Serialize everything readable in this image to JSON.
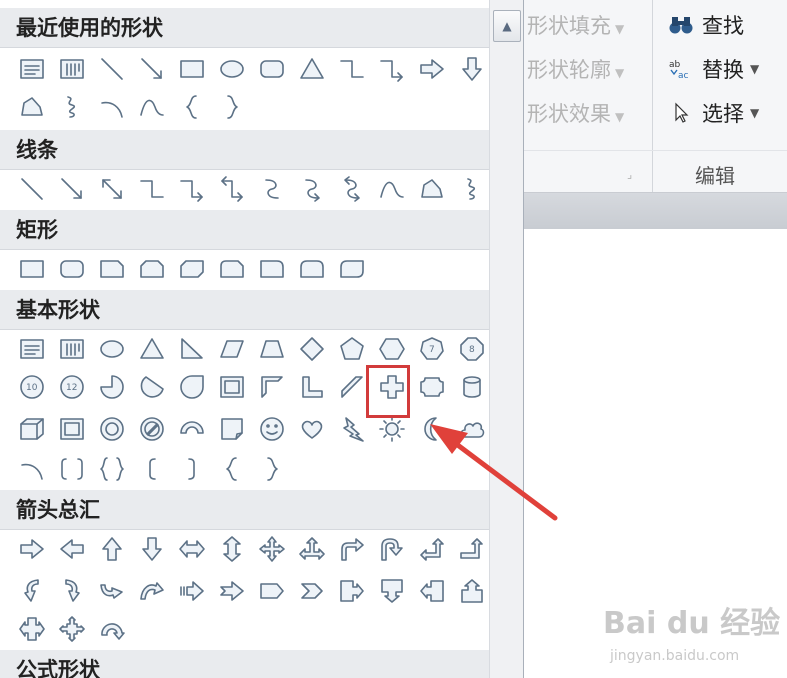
{
  "ribbon": {
    "format_items": [
      {
        "label": "形状填充",
        "has_dropdown": true
      },
      {
        "label": "形状轮廓",
        "has_dropdown": true
      },
      {
        "label": "形状效果",
        "has_dropdown": true
      }
    ],
    "edit_items": [
      {
        "label": "查找",
        "icon": "binoculars-icon",
        "has_dropdown": false
      },
      {
        "label": "替换",
        "icon": "replace-icon",
        "has_dropdown": true
      },
      {
        "label": "选择",
        "icon": "cursor-icon",
        "has_dropdown": true
      }
    ],
    "group_label": "编辑",
    "dropdown_glyph": "▼",
    "launcher_glyph": "⌟"
  },
  "panel": {
    "scroll_up_glyph": "▲",
    "sections": [
      {
        "title": "最近使用的形状",
        "icon_count": 21
      },
      {
        "title": "线条",
        "icon_count": 12
      },
      {
        "title": "矩形",
        "icon_count": 9
      },
      {
        "title": "基本形状",
        "icon_count": 42
      },
      {
        "title": "箭头总汇",
        "icon_count": 27
      },
      {
        "title": "公式形状",
        "icon_count": 0
      }
    ],
    "selected_shape": "plus-icon"
  },
  "overlay": {
    "highlight_color": "#d23b3b",
    "watermark": "Bai du 经验",
    "watermark_sub": "jingyan.baidu.com"
  }
}
